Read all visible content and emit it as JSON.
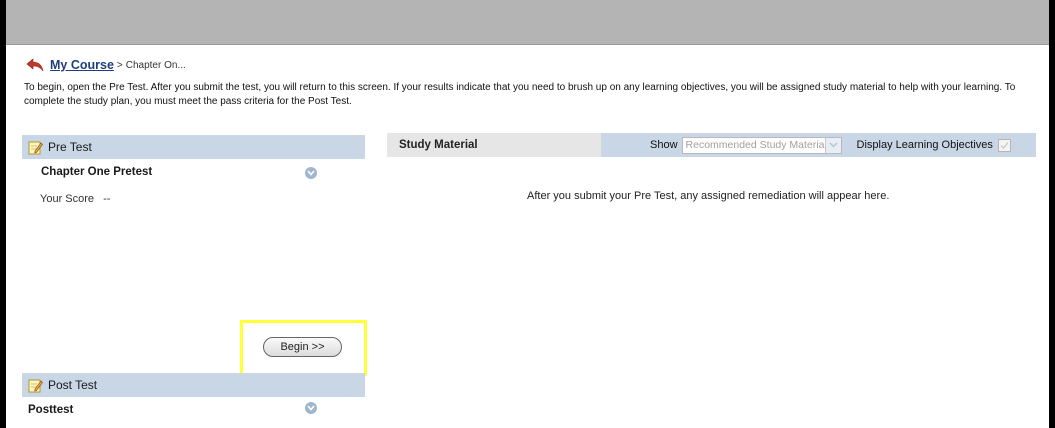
{
  "breadcrumb": {
    "link_label": "My Course",
    "separator": ">",
    "current": "Chapter On..."
  },
  "intro": {
    "text": "To begin, open the Pre Test. After you submit the test, you will return to this screen. If your results indicate that you need to brush up on any learning objectives, you will be assigned study material to help with your learning. To complete the study plan, you must meet the pass criteria for the Post Test."
  },
  "pretest": {
    "header": "Pre Test",
    "title": "Chapter One Pretest",
    "score_label": "Your Score",
    "score_value": "--",
    "begin_label": "Begin  >>"
  },
  "posttest": {
    "header": "Post Test",
    "title": "Posttest"
  },
  "study": {
    "title": "Study Material",
    "show_label": "Show",
    "select_value": "Recommended Study Material",
    "display_objectives_label": "Display Learning Objectives",
    "message": "After you submit your Pre Test, any assigned remediation will appear here."
  },
  "colors": {
    "top_bar": "#b4b4b4",
    "panel_header": "#c8d6e5",
    "link": "#1f3f7a",
    "highlight": "#ffff3a",
    "back_arrow": "#c0392b"
  },
  "icons": {
    "back": "back-arrow-icon",
    "note": "note-pencil-icon",
    "expand": "chevron-down-circle-icon",
    "select": "chevron-down-icon",
    "checkbox": "checkmark-icon"
  }
}
